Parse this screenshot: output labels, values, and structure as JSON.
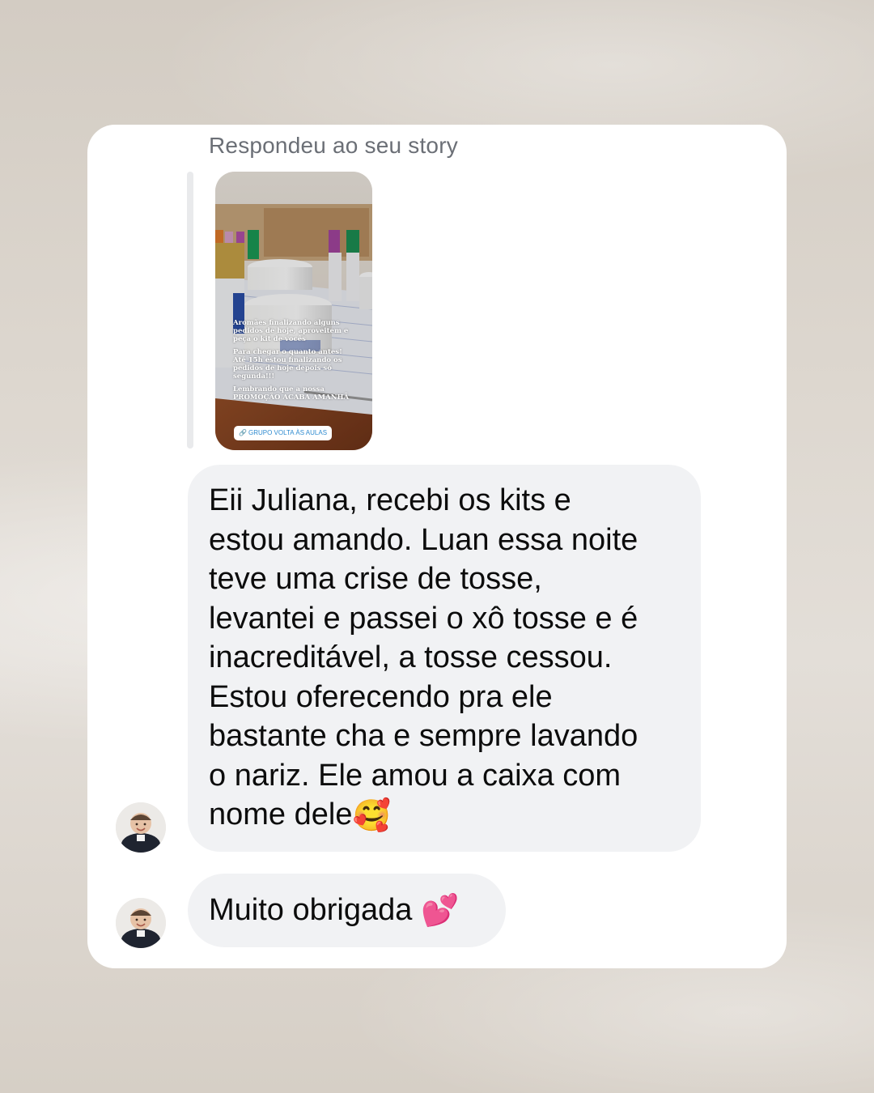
{
  "reply_caption": "Respondeu ao seu story",
  "story": {
    "paragraphs": [
      "Aromães finalizando alguns pedidos de hoje, aproveitem e peça o kit de vocês",
      "Para chegar o quanto antes! Até 15h estou finalizando os pedidos de hoje depois só segunda!!!",
      "Lembrando que a nossa PROMOÇÃO ACABA AMANHÃ"
    ],
    "link_label": "GRUPO VOLTA ÀS AULAS"
  },
  "messages": [
    {
      "text": "Eii Juliana, recebi os kits e\nestou amando. Luan essa noite\nteve uma crise de tosse,\nlevantei e passei o xô tosse e é\ninacreditável, a tosse cessou.\nEstou oferecendo pra ele\nbastante cha e sempre lavando\no nariz. Ele amou a caixa com\nnome dele",
      "emoji": "🥰"
    },
    {
      "text": "Muito obrigada ",
      "emoji": "💕"
    }
  ],
  "icons": {
    "story_link": "link-icon",
    "avatar": "baby-avatar",
    "emoji_1": "smiling-face-with-hearts",
    "emoji_2": "two-hearts"
  },
  "colors": {
    "bubble": "#f1f2f4",
    "caption": "#6b6f76",
    "card": "#ffffff"
  }
}
